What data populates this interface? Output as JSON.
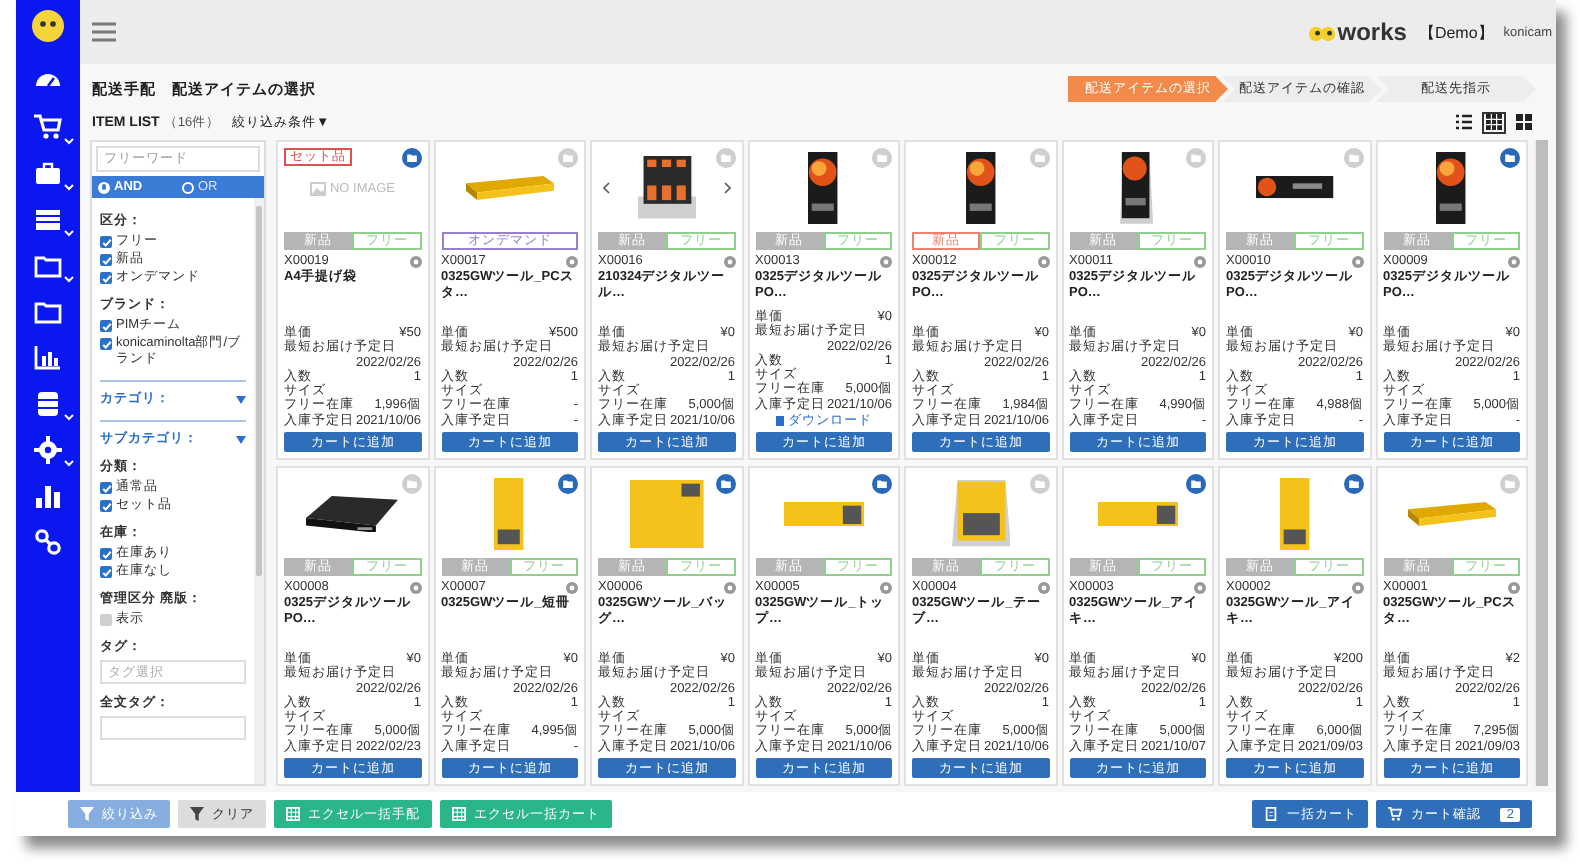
{
  "sidebar": {
    "items": [
      {
        "expandable": false
      },
      {
        "expandable": true
      },
      {
        "expandable": true
      },
      {
        "expandable": true
      },
      {
        "expandable": true
      },
      {
        "expandable": false
      },
      {
        "expandable": false
      },
      {
        "expandable": true
      },
      {
        "expandable": true
      },
      {
        "expandable": false
      },
      {
        "expandable": false
      }
    ]
  },
  "header": {
    "logo_text": "works",
    "edition": "【Demo】",
    "user": "konicam"
  },
  "breadcrumb": [
    "配送手配",
    "配送アイテムの選択"
  ],
  "steps": [
    {
      "label": "配送アイテムの選択",
      "selected": true
    },
    {
      "label": "配送アイテムの確認",
      "selected": false
    },
    {
      "label": "配送先指示",
      "selected": false
    }
  ],
  "list_header": {
    "title": "ITEM LIST",
    "count": "（16件）",
    "filter_toggle": "絞り込み条件▼"
  },
  "view_modes": [
    {
      "selected": false
    },
    {
      "selected": true
    },
    {
      "selected": false
    }
  ],
  "filter": {
    "freeword_placeholder": "フリーワード",
    "match": [
      {
        "label": "AND",
        "selected": true
      },
      {
        "label": "OR",
        "selected": false
      }
    ],
    "groups": [
      {
        "kind": "checks",
        "title": "区分：",
        "options": [
          {
            "label": "フリー",
            "checked": true
          },
          {
            "label": "新品",
            "checked": true
          },
          {
            "label": "オンデマンド",
            "checked": true
          }
        ]
      },
      {
        "kind": "checks",
        "title": "ブランド：",
        "options": [
          {
            "label": "PIMチーム",
            "checked": true
          },
          {
            "label": "konicaminolta部門/ブランド",
            "checked": true
          }
        ]
      },
      {
        "kind": "collapsible",
        "title": "カテゴリ："
      },
      {
        "kind": "collapsible",
        "title": "サブカテゴリ："
      },
      {
        "kind": "checks",
        "title": "分類：",
        "options": [
          {
            "label": "通常品",
            "checked": true
          },
          {
            "label": "セット品",
            "checked": true
          }
        ]
      },
      {
        "kind": "checks",
        "title": "在庫：",
        "options": [
          {
            "label": "在庫あり",
            "checked": true
          },
          {
            "label": "在庫なし",
            "checked": true
          }
        ]
      },
      {
        "kind": "checks",
        "title": "管理区分 廃版：",
        "options": [
          {
            "label": "表示",
            "checked": false
          }
        ]
      },
      {
        "kind": "input",
        "title": "タグ：",
        "placeholder": "タグ選択"
      },
      {
        "kind": "input",
        "title": "全文タグ："
      }
    ]
  },
  "items": [
    {
      "code": "X00019",
      "name": "A4手提げ袋",
      "image_text": "NO IMAGE",
      "set_badge": "セット品",
      "folder_on": true,
      "carousel": false,
      "tags": [
        {
          "label": "新品",
          "color": "#b5b5b5",
          "filled": true
        },
        {
          "label": "フリー",
          "color": "#8fd08f",
          "filled": false
        }
      ],
      "fields": [
        {
          "label": "単価",
          "value": "¥50"
        },
        {
          "label": "最短お届け予定日",
          "value": "2022/02/26"
        },
        {
          "label": "入数",
          "value": "1"
        },
        {
          "label": "サイズ"
        },
        {
          "label": "フリー在庫",
          "value": "1,996個"
        },
        {
          "label": "入庫予定日",
          "value": "2021/10/06"
        }
      ],
      "button": "カートに追加"
    },
    {
      "code": "X00017",
      "name": "0325GWツール_PCスタ…",
      "folder_on": false,
      "carousel": false,
      "tags": [
        {
          "label": "オンデマンド",
          "color": "#9a7fd0",
          "filled": false
        }
      ],
      "fields": [
        {
          "label": "単価",
          "value": "¥500"
        },
        {
          "label": "最短お届け予定日",
          "value": "2022/02/26"
        },
        {
          "label": "入数",
          "value": "1"
        },
        {
          "label": "サイズ"
        },
        {
          "label": "フリー在庫",
          "value": "-"
        },
        {
          "label": "入庫予定日",
          "value": "-"
        }
      ],
      "button": "カートに追加"
    },
    {
      "code": "X00016",
      "name": "210324デジタルツール…",
      "folder_on": false,
      "carousel": true,
      "tags": [
        {
          "label": "新品",
          "color": "#b5b5b5",
          "filled": true
        },
        {
          "label": "フリー",
          "color": "#8fd08f",
          "filled": false
        }
      ],
      "fields": [
        {
          "label": "単価",
          "value": "¥0"
        },
        {
          "label": "最短お届け予定日",
          "value": "2022/02/26"
        },
        {
          "label": "入数",
          "value": "1"
        },
        {
          "label": "サイズ"
        },
        {
          "label": "フリー在庫",
          "value": "5,000個"
        },
        {
          "label": "入庫予定日",
          "value": "2021/10/06"
        }
      ],
      "button": "カートに追加"
    },
    {
      "code": "X00013",
      "name": "0325デジタルツールPO…",
      "folder_on": false,
      "carousel": false,
      "tags": [
        {
          "label": "新品",
          "color": "#b5b5b5",
          "filled": true
        },
        {
          "label": "フリー",
          "color": "#8fd08f",
          "filled": false
        }
      ],
      "fields": [
        {
          "label": "単価",
          "value": "¥0"
        },
        {
          "label": "最短お届け予定日",
          "value": "2022/02/26"
        },
        {
          "label": "入数",
          "value": "1"
        },
        {
          "label": "サイズ"
        },
        {
          "label": "フリー在庫",
          "value": "5,000個"
        },
        {
          "label": "入庫予定日",
          "value": "2021/10/06"
        }
      ],
      "download": "ダウンロード",
      "button": "カートに追加"
    },
    {
      "code": "X00012",
      "name": "0325デジタルツールPO…",
      "folder_on": false,
      "carousel": false,
      "tags": [
        {
          "label": "新品",
          "color": "#f08070",
          "filled": false
        },
        {
          "label": "フリー",
          "color": "#8fd08f",
          "filled": false
        }
      ],
      "fields": [
        {
          "label": "単価",
          "value": "¥0"
        },
        {
          "label": "最短お届け予定日",
          "value": "2022/02/26"
        },
        {
          "label": "入数",
          "value": "1"
        },
        {
          "label": "サイズ"
        },
        {
          "label": "フリー在庫",
          "value": "1,984個"
        },
        {
          "label": "入庫予定日",
          "value": "2021/10/06"
        }
      ],
      "button": "カートに追加"
    },
    {
      "code": "X00011",
      "name": "0325デジタルツールPO…",
      "folder_on": false,
      "carousel": false,
      "tags": [
        {
          "label": "新品",
          "color": "#b5b5b5",
          "filled": true
        },
        {
          "label": "フリー",
          "color": "#8fd08f",
          "filled": false
        }
      ],
      "fields": [
        {
          "label": "単価",
          "value": "¥0"
        },
        {
          "label": "最短お届け予定日",
          "value": "2022/02/26"
        },
        {
          "label": "入数",
          "value": "1"
        },
        {
          "label": "サイズ"
        },
        {
          "label": "フリー在庫",
          "value": "4,990個"
        },
        {
          "label": "入庫予定日",
          "value": "-"
        }
      ],
      "button": "カートに追加"
    },
    {
      "code": "X00010",
      "name": "0325デジタルツールPO…",
      "folder_on": false,
      "carousel": false,
      "tags": [
        {
          "label": "新品",
          "color": "#b5b5b5",
          "filled": true
        },
        {
          "label": "フリー",
          "color": "#8fd08f",
          "filled": false
        }
      ],
      "fields": [
        {
          "label": "単価",
          "value": "¥0"
        },
        {
          "label": "最短お届け予定日",
          "value": "2022/02/26"
        },
        {
          "label": "入数",
          "value": "1"
        },
        {
          "label": "サイズ"
        },
        {
          "label": "フリー在庫",
          "value": "4,988個"
        },
        {
          "label": "入庫予定日",
          "value": "-"
        }
      ],
      "button": "カートに追加"
    },
    {
      "code": "X00009",
      "name": "0325デジタルツールPO…",
      "folder_on": true,
      "carousel": false,
      "tags": [
        {
          "label": "新品",
          "color": "#b5b5b5",
          "filled": true
        },
        {
          "label": "フリー",
          "color": "#8fd08f",
          "filled": false
        }
      ],
      "fields": [
        {
          "label": "単価",
          "value": "¥0"
        },
        {
          "label": "最短お届け予定日",
          "value": "2022/02/26"
        },
        {
          "label": "入数",
          "value": "1"
        },
        {
          "label": "サイズ"
        },
        {
          "label": "フリー在庫",
          "value": "5,000個"
        },
        {
          "label": "入庫予定日",
          "value": "-"
        }
      ],
      "button": "カートに追加"
    },
    {
      "code": "X00008",
      "name": "0325デジタルツールPO…",
      "folder_on": false,
      "carousel": false,
      "tags": [
        {
          "label": "新品",
          "color": "#b5b5b5",
          "filled": true
        },
        {
          "label": "フリー",
          "color": "#8fd08f",
          "filled": false
        }
      ],
      "fields": [
        {
          "label": "単価",
          "value": "¥0"
        },
        {
          "label": "最短お届け予定日",
          "value": "2022/02/26"
        },
        {
          "label": "入数",
          "value": "1"
        },
        {
          "label": "サイズ"
        },
        {
          "label": "フリー在庫",
          "value": "5,000個"
        },
        {
          "label": "入庫予定日",
          "value": "2022/02/23"
        }
      ],
      "button": "カートに追加"
    },
    {
      "code": "X00007",
      "name": "0325GWツール_短冊",
      "folder_on": true,
      "carousel": false,
      "tags": [
        {
          "label": "新品",
          "color": "#b5b5b5",
          "filled": true
        },
        {
          "label": "フリー",
          "color": "#8fd08f",
          "filled": false
        }
      ],
      "fields": [
        {
          "label": "単価",
          "value": "¥0"
        },
        {
          "label": "最短お届け予定日",
          "value": "2022/02/26"
        },
        {
          "label": "入数",
          "value": "1"
        },
        {
          "label": "サイズ"
        },
        {
          "label": "フリー在庫",
          "value": "4,995個"
        },
        {
          "label": "入庫予定日",
          "value": "-"
        }
      ],
      "button": "カートに追加"
    },
    {
      "code": "X00006",
      "name": "0325GWツール_バッグ…",
      "folder_on": true,
      "carousel": false,
      "tags": [
        {
          "label": "新品",
          "color": "#b5b5b5",
          "filled": true
        },
        {
          "label": "フリー",
          "color": "#8fd08f",
          "filled": false
        }
      ],
      "fields": [
        {
          "label": "単価",
          "value": "¥0"
        },
        {
          "label": "最短お届け予定日",
          "value": "2022/02/26"
        },
        {
          "label": "入数",
          "value": "1"
        },
        {
          "label": "サイズ"
        },
        {
          "label": "フリー在庫",
          "value": "5,000個"
        },
        {
          "label": "入庫予定日",
          "value": "2021/10/06"
        }
      ],
      "button": "カートに追加"
    },
    {
      "code": "X00005",
      "name": "0325GWツール_トップ…",
      "folder_on": true,
      "carousel": false,
      "tags": [
        {
          "label": "新品",
          "color": "#b5b5b5",
          "filled": true
        },
        {
          "label": "フリー",
          "color": "#8fd08f",
          "filled": false
        }
      ],
      "fields": [
        {
          "label": "単価",
          "value": "¥0"
        },
        {
          "label": "最短お届け予定日",
          "value": "2022/02/26"
        },
        {
          "label": "入数",
          "value": "1"
        },
        {
          "label": "サイズ"
        },
        {
          "label": "フリー在庫",
          "value": "5,000個"
        },
        {
          "label": "入庫予定日",
          "value": "2021/10/06"
        }
      ],
      "button": "カートに追加"
    },
    {
      "code": "X00004",
      "name": "0325GWツール_テーブ…",
      "folder_on": false,
      "carousel": false,
      "tags": [
        {
          "label": "新品",
          "color": "#b5b5b5",
          "filled": true
        },
        {
          "label": "フリー",
          "color": "#8fd08f",
          "filled": false
        }
      ],
      "fields": [
        {
          "label": "単価",
          "value": "¥0"
        },
        {
          "label": "最短お届け予定日",
          "value": "2022/02/26"
        },
        {
          "label": "入数",
          "value": "1"
        },
        {
          "label": "サイズ"
        },
        {
          "label": "フリー在庫",
          "value": "5,000個"
        },
        {
          "label": "入庫予定日",
          "value": "2021/10/06"
        }
      ],
      "button": "カートに追加"
    },
    {
      "code": "X00003",
      "name": "0325GWツール_アイキ…",
      "folder_on": true,
      "carousel": false,
      "tags": [
        {
          "label": "新品",
          "color": "#b5b5b5",
          "filled": true
        },
        {
          "label": "フリー",
          "color": "#8fd08f",
          "filled": false
        }
      ],
      "fields": [
        {
          "label": "単価",
          "value": "¥0"
        },
        {
          "label": "最短お届け予定日",
          "value": "2022/02/26"
        },
        {
          "label": "入数",
          "value": "1"
        },
        {
          "label": "サイズ"
        },
        {
          "label": "フリー在庫",
          "value": "5,000個"
        },
        {
          "label": "入庫予定日",
          "value": "2021/10/07"
        }
      ],
      "button": "カートに追加"
    },
    {
      "code": "X00002",
      "name": "0325GWツール_アイキ…",
      "folder_on": true,
      "carousel": false,
      "tags": [
        {
          "label": "新品",
          "color": "#b5b5b5",
          "filled": true
        },
        {
          "label": "フリー",
          "color": "#8fd08f",
          "filled": false
        }
      ],
      "fields": [
        {
          "label": "単価",
          "value": "¥200"
        },
        {
          "label": "最短お届け予定日",
          "value": "2022/02/26"
        },
        {
          "label": "入数",
          "value": "1"
        },
        {
          "label": "サイズ"
        },
        {
          "label": "フリー在庫",
          "value": "6,000個"
        },
        {
          "label": "入庫予定日",
          "value": "2021/09/03"
        }
      ],
      "button": "カートに追加"
    },
    {
      "code": "X00001",
      "name": "0325GWツール_PCスタ…",
      "folder_on": false,
      "carousel": false,
      "tags": [
        {
          "label": "新品",
          "color": "#b5b5b5",
          "filled": true
        },
        {
          "label": "フリー",
          "color": "#8fd08f",
          "filled": false
        }
      ],
      "fields": [
        {
          "label": "単価",
          "value": "¥2"
        },
        {
          "label": "最短お届け予定日",
          "value": "2022/02/26"
        },
        {
          "label": "入数",
          "value": "1"
        },
        {
          "label": "サイズ"
        },
        {
          "label": "フリー在庫",
          "value": "7,295個"
        },
        {
          "label": "入庫予定日",
          "value": "2021/09/03"
        }
      ],
      "button": "カートに追加"
    }
  ],
  "bottom_bar": {
    "left": [
      {
        "label": "絞り込み",
        "kind": "filter"
      },
      {
        "label": "クリア",
        "kind": "clear"
      },
      {
        "label": "エクセル一括手配",
        "kind": "excel"
      },
      {
        "label": "エクセル一括カート",
        "kind": "excel"
      }
    ],
    "right": [
      {
        "label": "一括カート",
        "kind": "bulk"
      },
      {
        "label": "カート確認",
        "kind": "cart",
        "badge": "2"
      }
    ]
  }
}
